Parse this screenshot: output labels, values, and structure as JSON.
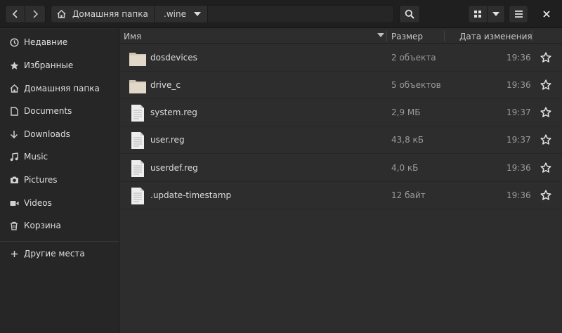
{
  "header": {
    "back_icon": "chevron-left-icon",
    "forward_icon": "chevron-right-icon",
    "breadcrumb": [
      {
        "label": "Домашняя папка",
        "icon": "home-icon"
      },
      {
        "label": ".wine",
        "icon": "dropdown-arrow-icon"
      }
    ],
    "search_icon": "search-icon",
    "view_icon": "grid-view-icon",
    "view_menu_icon": "dropdown-arrow-icon",
    "menu_icon": "hamburger-menu-icon",
    "close_icon": "close-icon"
  },
  "sidebar": {
    "items": [
      {
        "label": "Недавние",
        "icon": "clock-icon"
      },
      {
        "label": "Избранные",
        "icon": "star-icon"
      },
      {
        "label": "Домашняя папка",
        "icon": "home-icon"
      },
      {
        "label": "Documents",
        "icon": "document-icon"
      },
      {
        "label": "Downloads",
        "icon": "download-icon"
      },
      {
        "label": "Music",
        "icon": "music-icon"
      },
      {
        "label": "Pictures",
        "icon": "camera-icon"
      },
      {
        "label": "Videos",
        "icon": "video-icon"
      },
      {
        "label": "Корзина",
        "icon": "trash-icon"
      },
      {
        "label": "Другие места",
        "icon": "plus-icon"
      }
    ]
  },
  "columns": {
    "name": "Имя",
    "size": "Размер",
    "date": "Дата изменения"
  },
  "files": [
    {
      "name": "dosdevices",
      "size": "2 объекта",
      "time": "19:36",
      "type": "folder"
    },
    {
      "name": "drive_c",
      "size": "5 объектов",
      "time": "19:36",
      "type": "folder"
    },
    {
      "name": "system.reg",
      "size": "2,9 МБ",
      "time": "19:37",
      "type": "file"
    },
    {
      "name": "user.reg",
      "size": "43,8 кБ",
      "time": "19:37",
      "type": "file"
    },
    {
      "name": "userdef.reg",
      "size": "4,0 кБ",
      "time": "19:36",
      "type": "file"
    },
    {
      "name": ".update-timestamp",
      "size": "12 байт",
      "time": "19:36",
      "type": "file"
    }
  ],
  "colors": {
    "background": "#2d2d2d",
    "sidebar": "#262626",
    "headerbar": "#1f1f1f",
    "folder": "#e0d6c8"
  }
}
